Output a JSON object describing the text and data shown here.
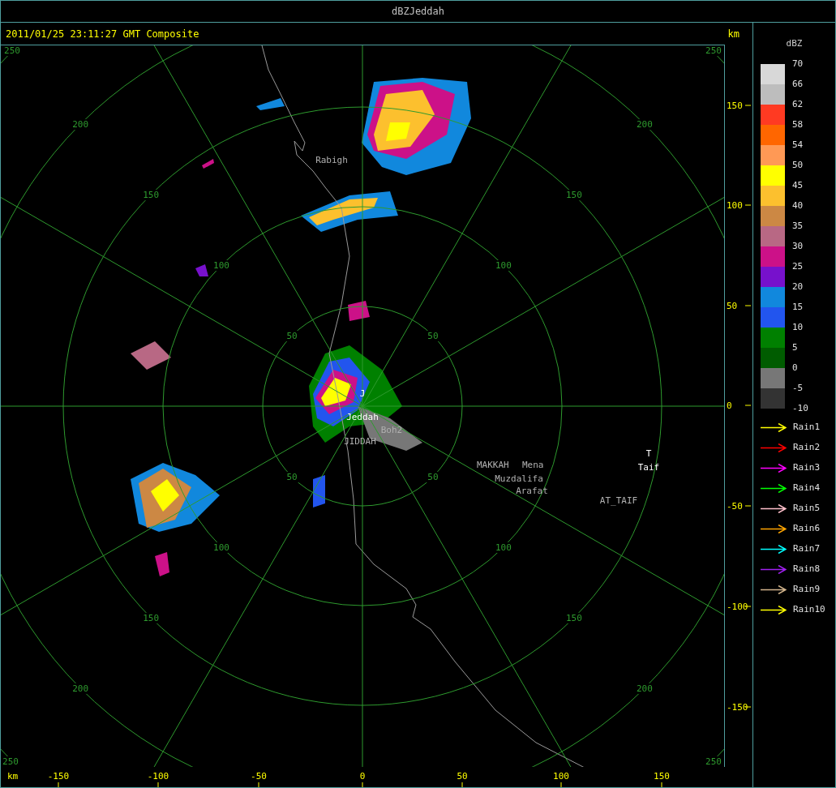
{
  "window": {
    "title": "dBZJeddah"
  },
  "header": {
    "timestamp": "2011/01/25 23:11:27 GMT Composite",
    "unit": "km"
  },
  "plot": {
    "rings": [
      {
        "labels": [
          "50",
          "50",
          "50",
          "50"
        ]
      },
      {
        "labels": [
          "100",
          "100",
          "100",
          "100"
        ]
      },
      {
        "labels": [
          "150",
          "150",
          "150",
          "150"
        ]
      },
      {
        "labels": [
          "200",
          "200",
          "200",
          "200"
        ]
      },
      {
        "labels": [
          "250",
          "250",
          "250",
          "250"
        ]
      }
    ],
    "places": [
      {
        "name": "Rabigh",
        "kind": "site"
      },
      {
        "name": "J",
        "kind": "city"
      },
      {
        "name": "Jeddah",
        "kind": "city"
      },
      {
        "name": "Boh2",
        "kind": "site"
      },
      {
        "name": "JIDDAH",
        "kind": "site"
      },
      {
        "name": "MAKKAH",
        "kind": "site"
      },
      {
        "name": "Mena",
        "kind": "site"
      },
      {
        "name": "Muzdalifa",
        "kind": "site"
      },
      {
        "name": "Arafat",
        "kind": "site"
      },
      {
        "name": "T",
        "kind": "city"
      },
      {
        "name": "Taif",
        "kind": "city"
      },
      {
        "name": "AT_TAIF",
        "kind": "site"
      }
    ]
  },
  "y_axis": {
    "ticks": [
      "150",
      "100",
      "50",
      "0",
      "-50",
      "-100",
      "-150"
    ]
  },
  "x_axis": {
    "unit": "km",
    "ticks": [
      "-150",
      "-100",
      "-50",
      "0",
      "50",
      "100",
      "150"
    ]
  },
  "legend": {
    "title": "dBZ",
    "bins": [
      {
        "color": "#d8d8d8"
      },
      {
        "color": "#bdbdbd"
      },
      {
        "color": "#ff3a22"
      },
      {
        "color": "#ff6600"
      },
      {
        "color": "#ff9955"
      },
      {
        "color": "#ffff00"
      },
      {
        "color": "#fcc02e"
      },
      {
        "color": "#cc8844"
      },
      {
        "color": "#b86884"
      },
      {
        "color": "#cc1188"
      },
      {
        "color": "#7711cc"
      },
      {
        "color": "#1188dd"
      },
      {
        "color": "#2255ee"
      },
      {
        "color": "#008000"
      },
      {
        "color": "#005c00"
      },
      {
        "color": "#777777"
      },
      {
        "color": "#333333"
      }
    ],
    "labels": [
      "70",
      "66",
      "62",
      "58",
      "54",
      "50",
      "45",
      "40",
      "35",
      "30",
      "25",
      "20",
      "15",
      "10",
      "5",
      "0",
      "-5",
      "-10"
    ],
    "tracks": [
      {
        "label": "Rain1",
        "color": "#ffff00"
      },
      {
        "label": "Rain2",
        "color": "#ff0000"
      },
      {
        "label": "Rain3",
        "color": "#ff00ff"
      },
      {
        "label": "Rain4",
        "color": "#00ff00"
      },
      {
        "label": "Rain5",
        "color": "#ffc0cb"
      },
      {
        "label": "Rain6",
        "color": "#ffa500"
      },
      {
        "label": "Rain7",
        "color": "#00ffff"
      },
      {
        "label": "Rain8",
        "color": "#a020f0"
      },
      {
        "label": "Rain9",
        "color": "#d2b48c"
      },
      {
        "label": "Rain10",
        "color": "#ffff00"
      }
    ]
  }
}
